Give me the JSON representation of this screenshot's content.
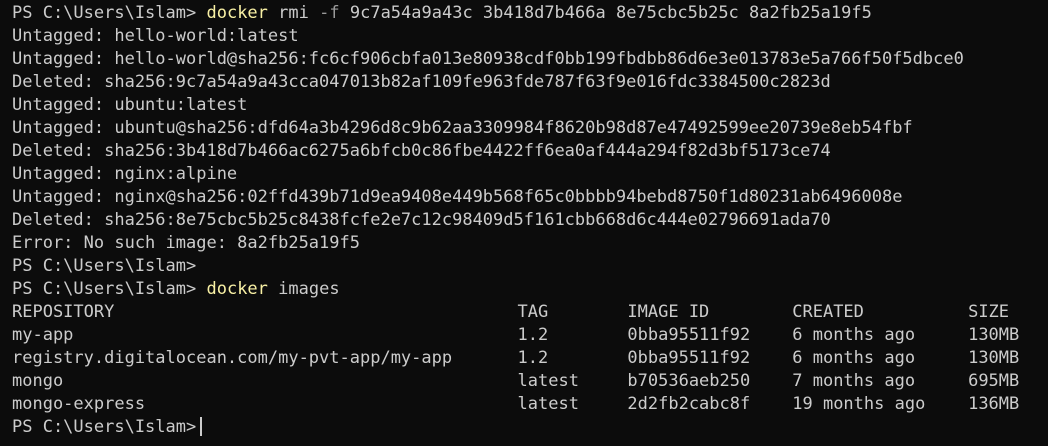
{
  "prompt": "PS C:\\Users\\Islam>",
  "commands": {
    "rmi": {
      "program": "docker",
      "subcommand": "rmi",
      "flag": "-f",
      "args": "9c7a54a9a43c 3b418d7b466a 8e75cbc5b25c 8a2fb25a19f5"
    },
    "images": {
      "program": "docker",
      "subcommand": "images"
    }
  },
  "rmi_output": [
    "Untagged: hello-world:latest",
    "Untagged: hello-world@sha256:fc6cf906cbfa013e80938cdf0bb199fbdbb86d6e3e013783e5a766f50f5dbce0",
    "Deleted: sha256:9c7a54a9a43cca047013b82af109fe963fde787f63f9e016fdc3384500c2823d",
    "Untagged: ubuntu:latest",
    "Untagged: ubuntu@sha256:dfd64a3b4296d8c9b62aa3309984f8620b98d87e47492599ee20739e8eb54fbf",
    "Deleted: sha256:3b418d7b466ac6275a6bfcb0c86fbe4422ff6ea0af444a294f82d3bf5173ce74",
    "Untagged: nginx:alpine",
    "Untagged: nginx@sha256:02ffd439b71d9ea9408e449b568f65c0bbbb94bebd8750f1d80231ab6496008e",
    "Deleted: sha256:8e75cbc5b25c8438fcfe2e7c12c98409d5f161cbb668d6c444e02796691ada70",
    "Error: No such image: 8a2fb25a19f5"
  ],
  "images_table": {
    "headers": [
      "REPOSITORY",
      "TAG",
      "IMAGE ID",
      "CREATED",
      "SIZE"
    ],
    "rows": [
      [
        "my-app",
        "1.2",
        "0bba95511f92",
        "6 months ago",
        "130MB"
      ],
      [
        "registry.digitalocean.com/my-pvt-app/my-app",
        "1.2",
        "0bba95511f92",
        "6 months ago",
        "130MB"
      ],
      [
        "mongo",
        "latest",
        "b70536aeb250",
        "7 months ago",
        "695MB"
      ],
      [
        "mongo-express",
        "latest",
        "2d2fb2cabc8f",
        "19 months ago",
        "136MB"
      ]
    ]
  },
  "colors": {
    "background": "#0c0c0c",
    "text": "#cccccc",
    "command": "#f9f1a5",
    "flag": "#9a9a9a"
  }
}
